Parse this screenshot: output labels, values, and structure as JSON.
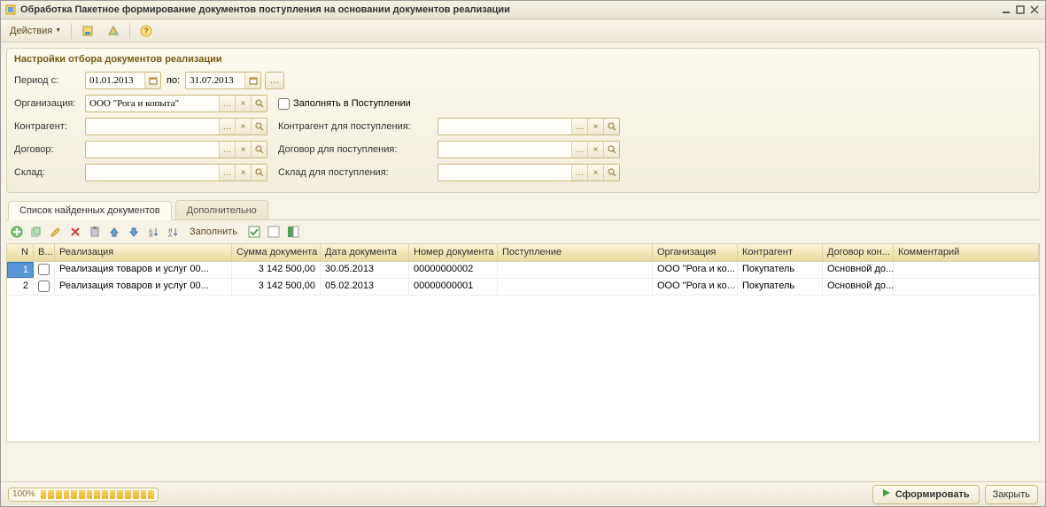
{
  "window": {
    "title": "Обработка  Пакетное формирование документов поступления на основании документов реализации"
  },
  "toolbar": {
    "actions": "Действия"
  },
  "settings": {
    "title": "Настройки отбора документов реализации",
    "period_from_label": "Период с:",
    "period_from": "01.01.2013",
    "period_to_label": "по:",
    "period_to": "31.07.2013",
    "org_label": "Организация:",
    "org_value": "ООО \"Рога и копыта\"",
    "fill_in_receipt": "Заполнять в Поступлении",
    "kontragent_label": "Контрагент:",
    "kontragent_value": "",
    "kontragent_post_label": "Контрагент для поступления:",
    "kontragent_post_value": "",
    "dogovor_label": "Договор:",
    "dogovor_value": "",
    "dogovor_post_label": "Договор для поступления:",
    "dogovor_post_value": "",
    "sklad_label": "Склад:",
    "sklad_value": "",
    "sklad_post_label": "Склад для поступления:",
    "sklad_post_value": ""
  },
  "tabs": {
    "found": "Список найденных документов",
    "extra": "Дополнительно"
  },
  "gridtoolbar": {
    "fill": "Заполнить"
  },
  "grid": {
    "headers": {
      "n": "N",
      "v": "В...",
      "real": "Реализация",
      "sum": "Сумма документа",
      "date": "Дата документа",
      "docnum": "Номер документа",
      "post": "Поступление",
      "org": "Организация",
      "kont": "Контрагент",
      "dog": "Договор кон...",
      "com": "Комментарий"
    },
    "rows": [
      {
        "n": "1",
        "checked": false,
        "real": "Реализация товаров и услуг 00...",
        "sum": "3 142 500,00",
        "date": "30.05.2013",
        "docnum": "00000000002",
        "post": "",
        "org": "ООО \"Рога и ко...",
        "kont": "Покупатель",
        "dog": "Основной до...",
        "com": ""
      },
      {
        "n": "2",
        "checked": false,
        "real": "Реализация товаров и услуг 00...",
        "sum": "3 142 500,00",
        "date": "05.02.2013",
        "docnum": "00000000001",
        "post": "",
        "org": "ООО \"Рога и ко...",
        "kont": "Покупатель",
        "dog": "Основной до...",
        "com": ""
      }
    ]
  },
  "footer": {
    "progress": "100%",
    "form": "Сформировать",
    "close": "Закрыть"
  }
}
